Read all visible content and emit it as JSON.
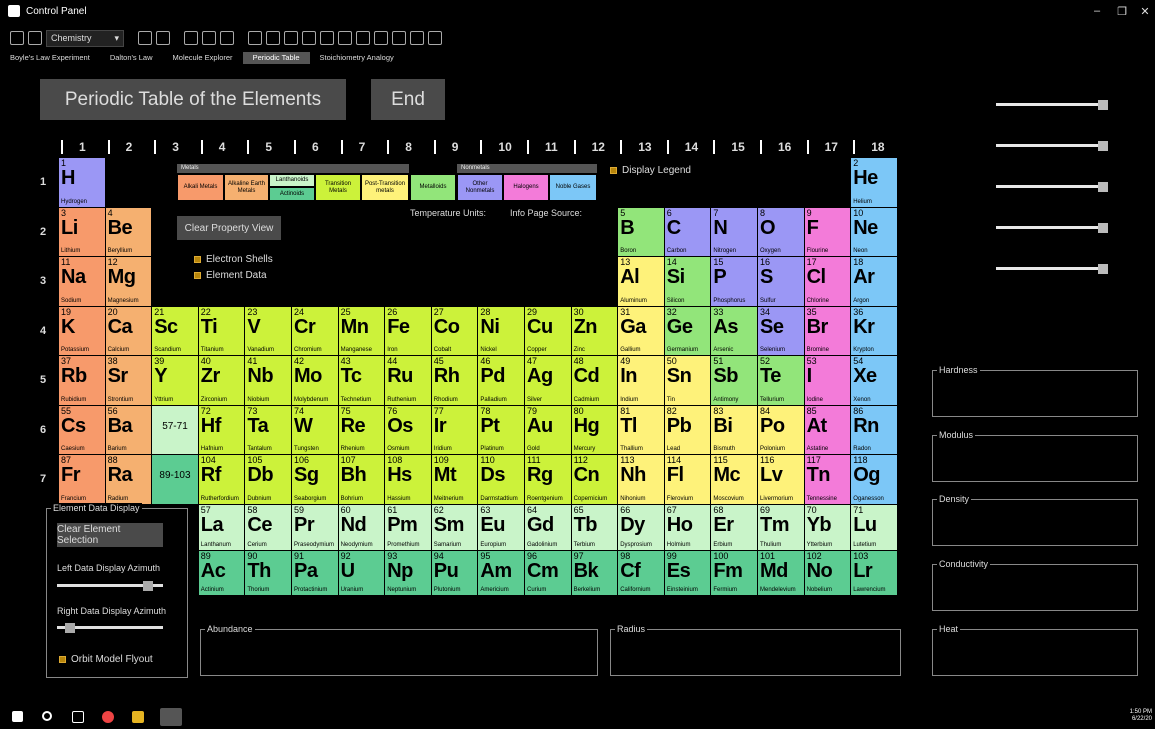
{
  "window": {
    "title": "Control Panel",
    "minimize": "–",
    "restore": "❐",
    "close": "✕"
  },
  "toolbar": {
    "dropdown_value": "Chemistry",
    "dropdown_arrow": "▾"
  },
  "tabs": [
    "Boyle's Law Experiment",
    "Dalton's Law",
    "Molecule Explorer",
    "Periodic Table",
    "Stoichiometry Analogy"
  ],
  "active_tab": "Periodic Table",
  "header": {
    "title": "Periodic Table of the Elements",
    "end_button": "End"
  },
  "groups": [
    "1",
    "2",
    "3",
    "4",
    "5",
    "6",
    "7",
    "8",
    "9",
    "10",
    "11",
    "12",
    "13",
    "14",
    "15",
    "16",
    "17",
    "18"
  ],
  "periods": [
    "1",
    "2",
    "3",
    "4",
    "5",
    "6",
    "7"
  ],
  "colors": {
    "alkali": "#f79a6b",
    "alkaline": "#f5b070",
    "lanthanoid": "#c9f4c9",
    "actinoid": "#5ccc92",
    "transition": "#ccf23a",
    "post_transition": "#fef27a",
    "metalloid": "#92e57a",
    "nonmetal": "#9b97f5",
    "halogen": "#f37bd9",
    "noble": "#7cc7f7",
    "accent": "#b8860b"
  },
  "legend": {
    "metals_header": "Metals",
    "nonmetals_header": "Nonmetals",
    "alkali": "Alkali Metals",
    "alkaline": "Alkaline Earth Metals",
    "lanthanoids": "Lanthanoids",
    "actinoids": "Actinoids",
    "transition": "Transition Metals",
    "post_transition": "Post-Transition metals",
    "metalloids": "Metalloids",
    "other_nonmetals": "Other Nonmetals",
    "halogens": "Halogens",
    "noble": "Noble Gases",
    "display_legend": "Display Legend"
  },
  "temperature_units": "Temperature Units:",
  "info_source": "Info Page Source:",
  "clear_property_view": "Clear Property View",
  "electron_shells": "Electron Shells",
  "element_data": "Element Data",
  "element_data_display": "Element Data Display",
  "clear_element_selection": "Clear Element Selection",
  "left_azimuth": "Left Data Display Azimuth",
  "right_azimuth": "Right Data Display Azimuth",
  "orbit_flyout": "Orbit Model Flyout",
  "panels": {
    "abundance": "Abundance",
    "radius": "Radius",
    "hardness": "Hardness",
    "modulus": "Modulus",
    "density": "Density",
    "conductivity": "Conductivity",
    "heat": "Heat"
  },
  "left_azimuth_level": 0.9,
  "right_azimuth_level": 0.08,
  "top_sliders": [
    1,
    1,
    1,
    1,
    1
  ],
  "placeholders": {
    "lanth": "57-71",
    "act": "89-103"
  },
  "clock": {
    "time": "1:50 PM",
    "date": "6/22/20"
  },
  "elements": [
    [
      "1",
      "H",
      "Hydrogen",
      1,
      1,
      "nonmetal"
    ],
    [
      "2",
      "He",
      "Helium",
      18,
      1,
      "noble"
    ],
    [
      "3",
      "Li",
      "Lithium",
      1,
      2,
      "alkali"
    ],
    [
      "4",
      "Be",
      "Beryllium",
      2,
      2,
      "alkaline"
    ],
    [
      "5",
      "B",
      "Boron",
      13,
      2,
      "metalloid"
    ],
    [
      "6",
      "C",
      "Carbon",
      14,
      2,
      "nonmetal"
    ],
    [
      "7",
      "N",
      "Nitrogen",
      15,
      2,
      "nonmetal"
    ],
    [
      "8",
      "O",
      "Oxygen",
      16,
      2,
      "nonmetal"
    ],
    [
      "9",
      "F",
      "Flourine",
      17,
      2,
      "halogen"
    ],
    [
      "10",
      "Ne",
      "Neon",
      18,
      2,
      "noble"
    ],
    [
      "11",
      "Na",
      "Sodium",
      1,
      3,
      "alkali"
    ],
    [
      "12",
      "Mg",
      "Magnesium",
      2,
      3,
      "alkaline"
    ],
    [
      "13",
      "Al",
      "Aluminum",
      13,
      3,
      "post_transition"
    ],
    [
      "14",
      "Si",
      "Silicon",
      14,
      3,
      "metalloid"
    ],
    [
      "15",
      "P",
      "Phosphorus",
      15,
      3,
      "nonmetal"
    ],
    [
      "16",
      "S",
      "Sulfur",
      16,
      3,
      "nonmetal"
    ],
    [
      "17",
      "Cl",
      "Chlorine",
      17,
      3,
      "halogen"
    ],
    [
      "18",
      "Ar",
      "Argon",
      18,
      3,
      "noble"
    ],
    [
      "19",
      "K",
      "Potassium",
      1,
      4,
      "alkali"
    ],
    [
      "20",
      "Ca",
      "Calcium",
      2,
      4,
      "alkaline"
    ],
    [
      "21",
      "Sc",
      "Scandium",
      3,
      4,
      "transition"
    ],
    [
      "22",
      "Ti",
      "Titanium",
      4,
      4,
      "transition"
    ],
    [
      "23",
      "V",
      "Vanadium",
      5,
      4,
      "transition"
    ],
    [
      "24",
      "Cr",
      "Chromium",
      6,
      4,
      "transition"
    ],
    [
      "25",
      "Mn",
      "Manganese",
      7,
      4,
      "transition"
    ],
    [
      "26",
      "Fe",
      "Iron",
      8,
      4,
      "transition"
    ],
    [
      "27",
      "Co",
      "Cobalt",
      9,
      4,
      "transition"
    ],
    [
      "28",
      "Ni",
      "Nickel",
      10,
      4,
      "transition"
    ],
    [
      "29",
      "Cu",
      "Copper",
      11,
      4,
      "transition"
    ],
    [
      "30",
      "Zn",
      "Zinc",
      12,
      4,
      "transition"
    ],
    [
      "31",
      "Ga",
      "Gallium",
      13,
      4,
      "post_transition"
    ],
    [
      "32",
      "Ge",
      "Germanium",
      14,
      4,
      "metalloid"
    ],
    [
      "33",
      "As",
      "Arsenic",
      15,
      4,
      "metalloid"
    ],
    [
      "34",
      "Se",
      "Selenium",
      16,
      4,
      "nonmetal"
    ],
    [
      "35",
      "Br",
      "Bromine",
      17,
      4,
      "halogen"
    ],
    [
      "36",
      "Kr",
      "Krypton",
      18,
      4,
      "noble"
    ],
    [
      "37",
      "Rb",
      "Rubidium",
      1,
      5,
      "alkali"
    ],
    [
      "38",
      "Sr",
      "Strontium",
      2,
      5,
      "alkaline"
    ],
    [
      "39",
      "Y",
      "Yttrium",
      3,
      5,
      "transition"
    ],
    [
      "40",
      "Zr",
      "Zirconium",
      4,
      5,
      "transition"
    ],
    [
      "41",
      "Nb",
      "Niobium",
      5,
      5,
      "transition"
    ],
    [
      "42",
      "Mo",
      "Molybdenum",
      6,
      5,
      "transition"
    ],
    [
      "43",
      "Tc",
      "Technetium",
      7,
      5,
      "transition"
    ],
    [
      "44",
      "Ru",
      "Ruthenium",
      8,
      5,
      "transition"
    ],
    [
      "45",
      "Rh",
      "Rhodium",
      9,
      5,
      "transition"
    ],
    [
      "46",
      "Pd",
      "Palladium",
      10,
      5,
      "transition"
    ],
    [
      "47",
      "Ag",
      "Silver",
      11,
      5,
      "transition"
    ],
    [
      "48",
      "Cd",
      "Cadmium",
      12,
      5,
      "transition"
    ],
    [
      "49",
      "In",
      "Indium",
      13,
      5,
      "post_transition"
    ],
    [
      "50",
      "Sn",
      "Tin",
      14,
      5,
      "post_transition"
    ],
    [
      "51",
      "Sb",
      "Antimony",
      15,
      5,
      "metalloid"
    ],
    [
      "52",
      "Te",
      "Tellurium",
      16,
      5,
      "metalloid"
    ],
    [
      "53",
      "I",
      "Iodine",
      17,
      5,
      "halogen"
    ],
    [
      "54",
      "Xe",
      "Xenon",
      18,
      5,
      "noble"
    ],
    [
      "55",
      "Cs",
      "Caesium",
      1,
      6,
      "alkali"
    ],
    [
      "56",
      "Ba",
      "Barium",
      2,
      6,
      "alkaline"
    ],
    [
      "72",
      "Hf",
      "Hafnium",
      4,
      6,
      "transition"
    ],
    [
      "73",
      "Ta",
      "Tantalum",
      5,
      6,
      "transition"
    ],
    [
      "74",
      "W",
      "Tungsten",
      6,
      6,
      "transition"
    ],
    [
      "75",
      "Re",
      "Rhenium",
      7,
      6,
      "transition"
    ],
    [
      "76",
      "Os",
      "Osmium",
      8,
      6,
      "transition"
    ],
    [
      "77",
      "Ir",
      "Iridium",
      9,
      6,
      "transition"
    ],
    [
      "78",
      "Pt",
      "Platinum",
      10,
      6,
      "transition"
    ],
    [
      "79",
      "Au",
      "Gold",
      11,
      6,
      "transition"
    ],
    [
      "80",
      "Hg",
      "Mercury",
      12,
      6,
      "transition"
    ],
    [
      "81",
      "Tl",
      "Thallium",
      13,
      6,
      "post_transition"
    ],
    [
      "82",
      "Pb",
      "Lead",
      14,
      6,
      "post_transition"
    ],
    [
      "83",
      "Bi",
      "Bismuth",
      15,
      6,
      "post_transition"
    ],
    [
      "84",
      "Po",
      "Polonium",
      16,
      6,
      "post_transition"
    ],
    [
      "85",
      "At",
      "Astatine",
      17,
      6,
      "halogen"
    ],
    [
      "86",
      "Rn",
      "Radon",
      18,
      6,
      "noble"
    ],
    [
      "87",
      "Fr",
      "Francium",
      1,
      7,
      "alkali"
    ],
    [
      "88",
      "Ra",
      "Radium",
      2,
      7,
      "alkaline"
    ],
    [
      "104",
      "Rf",
      "Rutherfordium",
      4,
      7,
      "transition"
    ],
    [
      "105",
      "Db",
      "Dubnium",
      5,
      7,
      "transition"
    ],
    [
      "106",
      "Sg",
      "Seaborgium",
      6,
      7,
      "transition"
    ],
    [
      "107",
      "Bh",
      "Bohrium",
      7,
      7,
      "transition"
    ],
    [
      "108",
      "Hs",
      "Hassium",
      8,
      7,
      "transition"
    ],
    [
      "109",
      "Mt",
      "Meitnerium",
      9,
      7,
      "transition"
    ],
    [
      "110",
      "Ds",
      "Darmstadtium",
      10,
      7,
      "transition"
    ],
    [
      "111",
      "Rg",
      "Roentgenium",
      11,
      7,
      "transition"
    ],
    [
      "112",
      "Cn",
      "Copernicium",
      12,
      7,
      "transition"
    ],
    [
      "113",
      "Nh",
      "Nihonium",
      13,
      7,
      "post_transition"
    ],
    [
      "114",
      "Fl",
      "Flerovium",
      14,
      7,
      "post_transition"
    ],
    [
      "115",
      "Mc",
      "Moscovium",
      15,
      7,
      "post_transition"
    ],
    [
      "116",
      "Lv",
      "Livermorium",
      16,
      7,
      "post_transition"
    ],
    [
      "117",
      "Tn",
      "Tennessine",
      17,
      7,
      "halogen"
    ],
    [
      "118",
      "Og",
      "Oganesson",
      18,
      7,
      "noble"
    ],
    [
      "57",
      "La",
      "Lanthanum",
      4,
      9,
      "lanthanoid"
    ],
    [
      "58",
      "Ce",
      "Cerium",
      5,
      9,
      "lanthanoid"
    ],
    [
      "59",
      "Pr",
      "Praseodymium",
      6,
      9,
      "lanthanoid"
    ],
    [
      "60",
      "Nd",
      "Neodymium",
      7,
      9,
      "lanthanoid"
    ],
    [
      "61",
      "Pm",
      "Promethium",
      8,
      9,
      "lanthanoid"
    ],
    [
      "62",
      "Sm",
      "Samarium",
      9,
      9,
      "lanthanoid"
    ],
    [
      "63",
      "Eu",
      "Europium",
      10,
      9,
      "lanthanoid"
    ],
    [
      "64",
      "Gd",
      "Gadolinium",
      11,
      9,
      "lanthanoid"
    ],
    [
      "65",
      "Tb",
      "Terbium",
      12,
      9,
      "lanthanoid"
    ],
    [
      "66",
      "Dy",
      "Dysprosium",
      13,
      9,
      "lanthanoid"
    ],
    [
      "67",
      "Ho",
      "Holmium",
      14,
      9,
      "lanthanoid"
    ],
    [
      "68",
      "Er",
      "Erbium",
      15,
      9,
      "lanthanoid"
    ],
    [
      "69",
      "Tm",
      "Thulium",
      16,
      9,
      "lanthanoid"
    ],
    [
      "70",
      "Yb",
      "Ytterbium",
      17,
      9,
      "lanthanoid"
    ],
    [
      "71",
      "Lu",
      "Lutetium",
      18,
      9,
      "lanthanoid"
    ],
    [
      "89",
      "Ac",
      "Actinium",
      4,
      10,
      "actinoid"
    ],
    [
      "90",
      "Th",
      "Thorium",
      5,
      10,
      "actinoid"
    ],
    [
      "91",
      "Pa",
      "Protactinium",
      6,
      10,
      "actinoid"
    ],
    [
      "92",
      "U",
      "Uranium",
      7,
      10,
      "actinoid"
    ],
    [
      "93",
      "Np",
      "Neptunium",
      8,
      10,
      "actinoid"
    ],
    [
      "94",
      "Pu",
      "Plutonium",
      9,
      10,
      "actinoid"
    ],
    [
      "95",
      "Am",
      "Americium",
      10,
      10,
      "actinoid"
    ],
    [
      "96",
      "Cm",
      "Curium",
      11,
      10,
      "actinoid"
    ],
    [
      "97",
      "Bk",
      "Berkelium",
      12,
      10,
      "actinoid"
    ],
    [
      "98",
      "Cf",
      "Californium",
      13,
      10,
      "actinoid"
    ],
    [
      "99",
      "Es",
      "Einsteinium",
      14,
      10,
      "actinoid"
    ],
    [
      "100",
      "Fm",
      "Fermium",
      15,
      10,
      "actinoid"
    ],
    [
      "101",
      "Md",
      "Mendelevium",
      16,
      10,
      "actinoid"
    ],
    [
      "102",
      "No",
      "Nobelium",
      17,
      10,
      "actinoid"
    ],
    [
      "103",
      "Lr",
      "Lawrencium",
      18,
      10,
      "actinoid"
    ]
  ]
}
